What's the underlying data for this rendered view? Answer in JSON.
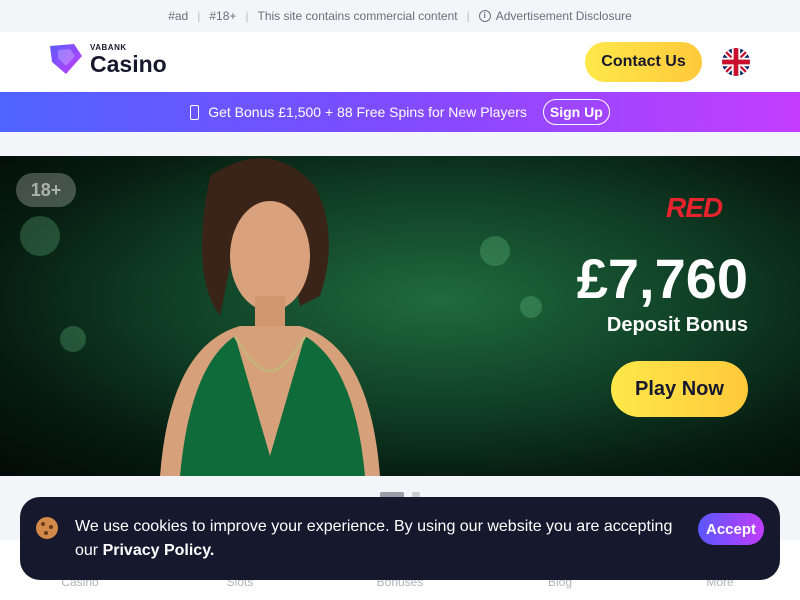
{
  "topbar": {
    "ad": "#ad",
    "age": "#18+",
    "commercial": "This site contains commercial content",
    "disclosure": "Advertisement Disclosure"
  },
  "header": {
    "logo_small": "VABANK",
    "logo_big": "Casino",
    "contact_label": "Contact Us",
    "language_icon": "uk-flag-icon"
  },
  "promo": {
    "text": "Get Bonus £1,500 + 88 Free Spins for New Players",
    "signup_label": "Sign Up"
  },
  "hero": {
    "age_badge": "18+",
    "brand": "RED",
    "amount": "£7,760",
    "subtitle": "Deposit Bonus",
    "play_label": "Play Now"
  },
  "nav": {
    "items": [
      {
        "label": "Casino"
      },
      {
        "label": "Slots"
      },
      {
        "label": "Bonuses"
      },
      {
        "label": "Blog"
      },
      {
        "label": "More"
      }
    ]
  },
  "cookie": {
    "text": "We use cookies to improve your experience. By using our website you are accepting our",
    "link_label": "Privacy Policy.",
    "accept_label": "Accept"
  },
  "colors": {
    "accent_yellow": "#ffd43a",
    "brand_dark": "#16182d",
    "promo_gradient_start": "#4f63ff",
    "promo_gradient_end": "#c43dff"
  }
}
